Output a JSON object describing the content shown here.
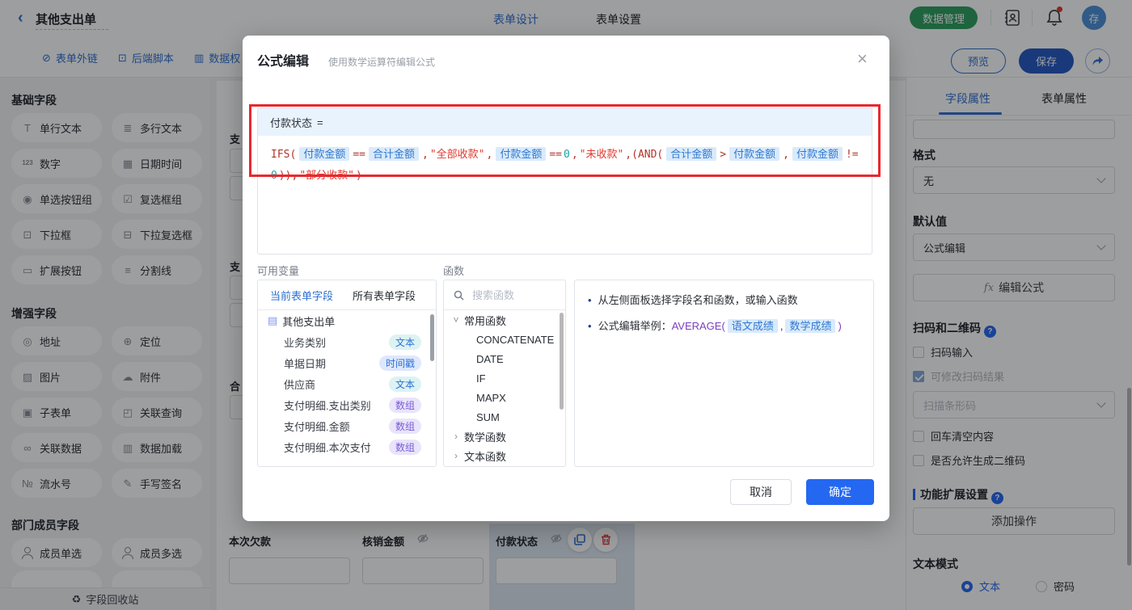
{
  "topbar": {
    "title": "其他支出单",
    "tabs": [
      "表单设计",
      "表单设置"
    ],
    "data_manage": "数据管理",
    "avatar": "存"
  },
  "toolbar": {
    "links": [
      {
        "label": "表单外链",
        "icon": "⊘",
        "icon_name": "external-link-icon"
      },
      {
        "label": "后端脚本",
        "icon": "⊡",
        "icon_name": "backend-script-icon"
      },
      {
        "label": "数据权",
        "icon": "▥",
        "icon_name": "data-permission-icon"
      }
    ],
    "preview": "预览",
    "save": "保存"
  },
  "sidebar": {
    "sections": [
      {
        "title": "基础字段",
        "items": [
          {
            "label": "单行文本",
            "icon": "T",
            "icon_name": "single-line-text-icon"
          },
          {
            "label": "多行文本",
            "icon": "≣",
            "icon_name": "multiline-text-icon"
          },
          {
            "label": "数字",
            "icon": "123",
            "icls": "ic-sm",
            "icon_name": "number-icon"
          },
          {
            "label": "日期时间",
            "icon": "▦",
            "icon_name": "datetime-icon"
          },
          {
            "label": "单选按钮组",
            "icon": "◉",
            "icon_name": "radio-group-icon"
          },
          {
            "label": "复选框组",
            "icon": "☑",
            "icon_name": "checkbox-group-icon"
          },
          {
            "label": "下拉框",
            "icon": "⊡",
            "icon_name": "select-icon"
          },
          {
            "label": "下拉复选框",
            "icon": "⊟",
            "icon_name": "multi-select-icon"
          },
          {
            "label": "扩展按钮",
            "icon": "▭",
            "icon_name": "extend-button-icon"
          },
          {
            "label": "分割线",
            "icon": "≡",
            "icon_name": "divider-icon"
          }
        ]
      },
      {
        "title": "增强字段",
        "items": [
          {
            "label": "地址",
            "icon": "◎",
            "icon_name": "address-icon"
          },
          {
            "label": "定位",
            "icon": "⊕",
            "icon_name": "location-icon"
          },
          {
            "label": "图片",
            "icon": "▨",
            "icon_name": "image-icon"
          },
          {
            "label": "附件",
            "icon": "☁",
            "icon_name": "attachment-icon"
          },
          {
            "label": "子表单",
            "icon": "▣",
            "icon_name": "subform-icon"
          },
          {
            "label": "关联查询",
            "icon": "◰",
            "icon_name": "related-query-icon"
          },
          {
            "label": "关联数据",
            "icon": "∞",
            "icon_name": "related-data-icon"
          },
          {
            "label": "数据加载",
            "icon": "▥",
            "icon_name": "data-load-icon"
          },
          {
            "label": "流水号",
            "icon": "№",
            "icon_name": "serial-number-icon"
          },
          {
            "label": "手写签名",
            "icon": "✎",
            "icon_name": "signature-icon"
          }
        ]
      },
      {
        "title": "部门成员字段",
        "items": [
          {
            "label": "成员单选",
            "icon": "",
            "icon_name": "member-single-icon"
          },
          {
            "label": "成员多选",
            "icon": "",
            "icon_name": "member-multi-icon"
          }
        ]
      }
    ],
    "recycle": "字段回收站"
  },
  "canvas": {
    "partials": [
      "支",
      "支",
      "合"
    ],
    "fields": [
      {
        "label": "本次欠款"
      },
      {
        "label": "核销金额"
      },
      {
        "label": "付款状态"
      }
    ]
  },
  "modal": {
    "title": "公式编辑",
    "subtitle": "使用数学运算符编辑公式",
    "target": "付款状态",
    "eq": "=",
    "tokens": [
      {
        "c": "code",
        "v": "IFS("
      },
      {
        "c": "field",
        "v": "付款金额"
      },
      {
        "c": "code",
        "v": "=="
      },
      {
        "c": "field",
        "v": "合计金额"
      },
      {
        "c": "code",
        "v": ","
      },
      {
        "c": "str",
        "v": "\"全部收款\""
      },
      {
        "c": "code",
        "v": ","
      },
      {
        "c": "field",
        "v": "付款金额"
      },
      {
        "c": "code",
        "v": "=="
      },
      {
        "c": "num",
        "v": "0"
      },
      {
        "c": "code",
        "v": ","
      },
      {
        "c": "str",
        "v": "\"未收款\""
      },
      {
        "c": "code",
        "v": ",(AND("
      },
      {
        "c": "field",
        "v": "合计金额"
      },
      {
        "c": "code",
        "v": ">"
      },
      {
        "c": "field",
        "v": "付款金额"
      },
      {
        "c": "code",
        "v": ","
      },
      {
        "c": "field",
        "v": "付款金额"
      },
      {
        "c": "code",
        "v": "!="
      },
      {
        "c": "num",
        "v": "0"
      },
      {
        "c": "code",
        "v": ")),"
      },
      {
        "c": "str",
        "v": "\"部分收款\""
      },
      {
        "c": "code",
        "v": ")"
      }
    ],
    "vars_label": "可用变量",
    "funcs_label": "函数",
    "vars_tabs": [
      "当前表单字段",
      "所有表单字段"
    ],
    "form_name": "其他支出单",
    "fields": [
      {
        "name": "业务类别",
        "type": "文本",
        "tcls": "t-text"
      },
      {
        "name": "单据日期",
        "type": "时间戳",
        "tcls": "t-time"
      },
      {
        "name": "供应商",
        "type": "文本",
        "tcls": "t-text"
      },
      {
        "name": "支付明细.支出类别",
        "type": "数组",
        "tcls": "t-arr"
      },
      {
        "name": "支付明细.金额",
        "type": "数组",
        "tcls": "t-arr"
      },
      {
        "name": "支付明细.本次支付",
        "type": "数组",
        "tcls": "t-arr"
      }
    ],
    "search_placeholder": "搜索函数",
    "functions": [
      {
        "v": "常用函数",
        "cls": "grp",
        "icon": "˅"
      },
      {
        "v": "CONCATENATE",
        "cls": "fn",
        "icon": ""
      },
      {
        "v": "DATE",
        "cls": "fn",
        "icon": ""
      },
      {
        "v": "IF",
        "cls": "fn",
        "icon": ""
      },
      {
        "v": "MAPX",
        "cls": "fn",
        "icon": ""
      },
      {
        "v": "SUM",
        "cls": "fn",
        "icon": ""
      },
      {
        "v": "数学函数",
        "cls": "grp",
        "icon": "›"
      },
      {
        "v": "文本函数",
        "cls": "grp",
        "icon": "›"
      }
    ],
    "tip1": "从左侧面板选择字段名和函数，或输入函数",
    "tip2_prefix": "公式编辑举例：",
    "tip2_fn": "AVERAGE(",
    "tip2_arg1": "语文成绩",
    "tip2_comma": ",",
    "tip2_arg2": "数学成绩",
    "tip2_close": ")",
    "cancel": "取消",
    "ok": "确定"
  },
  "panel": {
    "tabs": [
      "字段属性",
      "表单属性"
    ],
    "format_label": "格式",
    "format_value": "无",
    "default_label": "默认值",
    "default_value": "公式编辑",
    "fx": "fx",
    "edit_formula": "编辑公式",
    "scan_title": "扫码和二维码",
    "cb_scan": "扫码输入",
    "cb_edit": "可修改扫码结果",
    "scan_type": "扫描条形码",
    "cb_clear": "回车清空内容",
    "cb_qr": "是否允许生成二维码",
    "ext_title": "功能扩展设置",
    "add_action": "添加操作",
    "mode_label": "文本模式",
    "mode_text": "文本",
    "mode_pwd": "密码"
  }
}
